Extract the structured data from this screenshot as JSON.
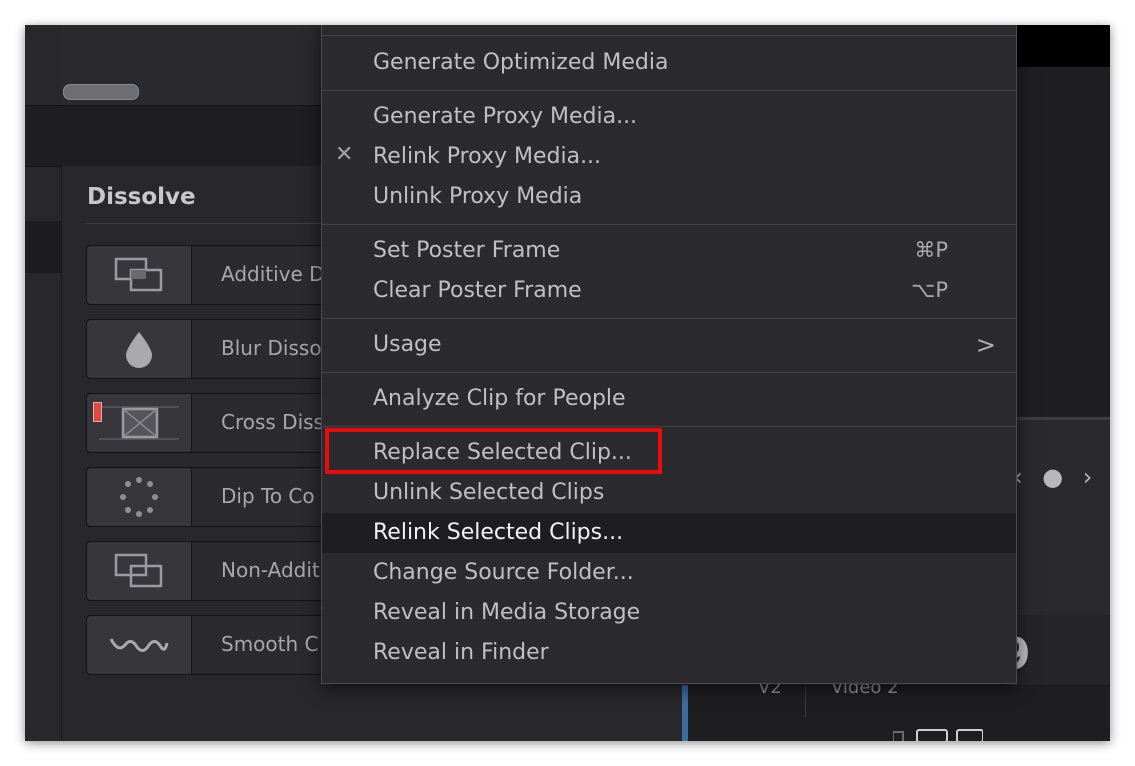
{
  "dissolve_panel": {
    "title": "Dissolve",
    "items": [
      {
        "label": "Additive D",
        "icon": "overlapping-rectangles-icon"
      },
      {
        "label": "Blur Disso",
        "icon": "droplet-icon"
      },
      {
        "label": "Cross Diss",
        "icon": "cross-dissolve-icon"
      },
      {
        "label": "Dip To Co",
        "icon": "dotted-circle-icon"
      },
      {
        "label": "Non-Additi",
        "icon": "overlapping-rectangles-icon"
      },
      {
        "label": "Smooth C",
        "icon": "wave-icon"
      }
    ]
  },
  "context_menu": {
    "items": [
      {
        "label": "Generate Optimized Media"
      },
      {
        "label": "Generate Proxy Media..."
      },
      {
        "label": "Relink Proxy Media...",
        "check": "✕"
      },
      {
        "label": "Unlink Proxy Media"
      },
      {
        "label": "Set Poster Frame",
        "shortcut": "⌘P"
      },
      {
        "label": "Clear Poster Frame",
        "shortcut": "⌥P"
      },
      {
        "label": "Usage",
        "submenu": ">"
      },
      {
        "label": "Analyze Clip for People"
      },
      {
        "label": "Replace Selected Clip..."
      },
      {
        "label": "Unlink Selected Clips"
      },
      {
        "label": "Relink Selected Clips..."
      },
      {
        "label": "Change Source Folder..."
      },
      {
        "label": "Reveal in Media Storage"
      },
      {
        "label": "Reveal in Finder"
      }
    ],
    "highlighted": "Relink Selected Clips...",
    "annotated": "Replace Selected Clip..."
  },
  "viewer": {
    "nav_glyphs": "‹ ● ›",
    "timecode_fragment": "9"
  },
  "timeline": {
    "track_label": "V2",
    "track_name": "Video 2"
  },
  "colors": {
    "annotation_box": "#e80c0c",
    "menu_bg": "#2b2b2f",
    "highlight_bg": "#1e1e21",
    "clip_marker": "#d94b44"
  }
}
